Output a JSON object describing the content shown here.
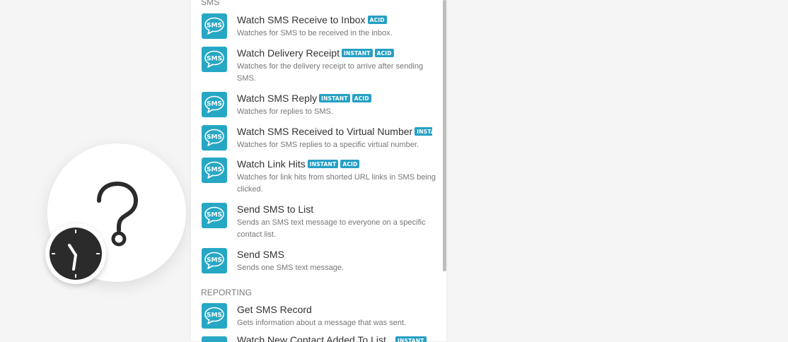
{
  "sections": {
    "sms": "SMS",
    "reporting": "REPORTING"
  },
  "items": [
    {
      "title": "Watch SMS Receive to Inbox",
      "badges": [
        "ACID"
      ],
      "desc": "Watches for SMS to be received in the inbox."
    },
    {
      "title": "Watch Delivery Receipt",
      "badges": [
        "INSTANT",
        "ACID"
      ],
      "desc": "Watches for the delivery receipt to arrive after sending SMS."
    },
    {
      "title": "Watch SMS Reply",
      "badges": [
        "INSTANT",
        "ACID"
      ],
      "desc": "Watches for replies to SMS."
    },
    {
      "title": "Watch SMS Received to Virtual Number",
      "badges": [
        "INSTANT"
      ],
      "desc": "Watches for SMS replies to a specific virtual number."
    },
    {
      "title": "Watch Link Hits",
      "badges": [
        "INSTANT",
        "ACID"
      ],
      "desc": "Watches for link hits from shorted URL links in SMS being clicked."
    },
    {
      "title": "Send SMS to List",
      "badges": [],
      "desc": "Sends an SMS text message to everyone on a specific contact list."
    },
    {
      "title": "Send SMS",
      "badges": [],
      "desc": "Sends one SMS text message."
    },
    {
      "title": "Get SMS Record",
      "badges": [],
      "desc": "Gets information about a message that was sent."
    },
    {
      "title": "Watch New Contact Added To List",
      "badges": [
        "INSTANT"
      ],
      "desc": ""
    }
  ],
  "icon_label": "SMS",
  "icons": {
    "module": "question-mark-icon",
    "badge": "clock-icon"
  },
  "colors": {
    "accent": "#26a7c4",
    "badge": "#26a0c4",
    "background": "#f5f5f5",
    "clock": "#2b2b2b"
  }
}
